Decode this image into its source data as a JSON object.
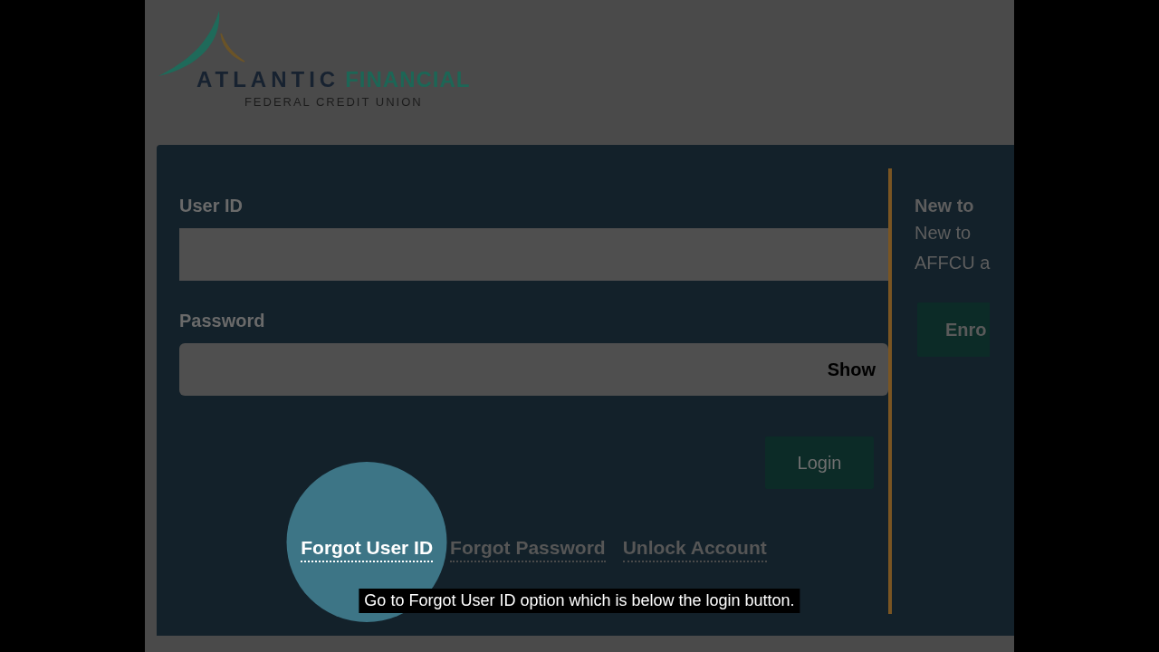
{
  "logo": {
    "name_first": "ATLANTIC",
    "name_second": "FINANCIAL",
    "tagline": "FEDERAL CREDIT UNION"
  },
  "login_form": {
    "fields": [
      {
        "kind": "text",
        "label": "User ID"
      },
      {
        "kind": "password",
        "label": "Password",
        "toggle": "Show"
      }
    ],
    "submit": "Login",
    "links": [
      {
        "label": "Forgot User ID",
        "highlighted": true
      },
      {
        "label": "Forgot Password",
        "highlighted": false
      },
      {
        "label": "Unlock Account",
        "highlighted": false
      }
    ]
  },
  "enroll_panel": {
    "heading": "New to",
    "lines": [
      "New to",
      "AFFCU a"
    ],
    "button": "Enro"
  },
  "caption": "Go to Forgot User ID option which is below the login button."
}
